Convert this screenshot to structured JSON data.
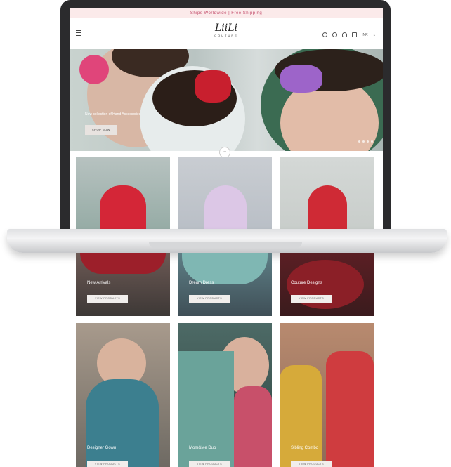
{
  "announcement": "Ships Worldwide | Free Shipping",
  "logo": {
    "main": "LiiLi",
    "sub": "COUTURE"
  },
  "header": {
    "currency": "INR"
  },
  "hero": {
    "caption": "New collection of Hand Accessories",
    "button": "SHOP NOW"
  },
  "tiles": [
    {
      "label": "New Arrivals",
      "button": "VIEW PRODUCTS"
    },
    {
      "label": "Dream Dress",
      "button": "VIEW PRODUCTS"
    },
    {
      "label": "Couture Designs",
      "button": "VIEW PRODUCTS"
    },
    {
      "label": "Designer Gown",
      "button": "VIEW PRODUCTS"
    },
    {
      "label": "Mom&Me Duo",
      "button": "VIEW PRODUCTS"
    },
    {
      "label": "Sibling Combo",
      "button": "VIEW PRODUCTS"
    }
  ],
  "icons": [
    "menu-icon",
    "account-icon",
    "search-icon",
    "wishlist-icon",
    "cart-icon",
    "chevron-down-icon"
  ],
  "colors": {
    "accent": "#c24b6a",
    "laptop": "#2b2b2d"
  }
}
